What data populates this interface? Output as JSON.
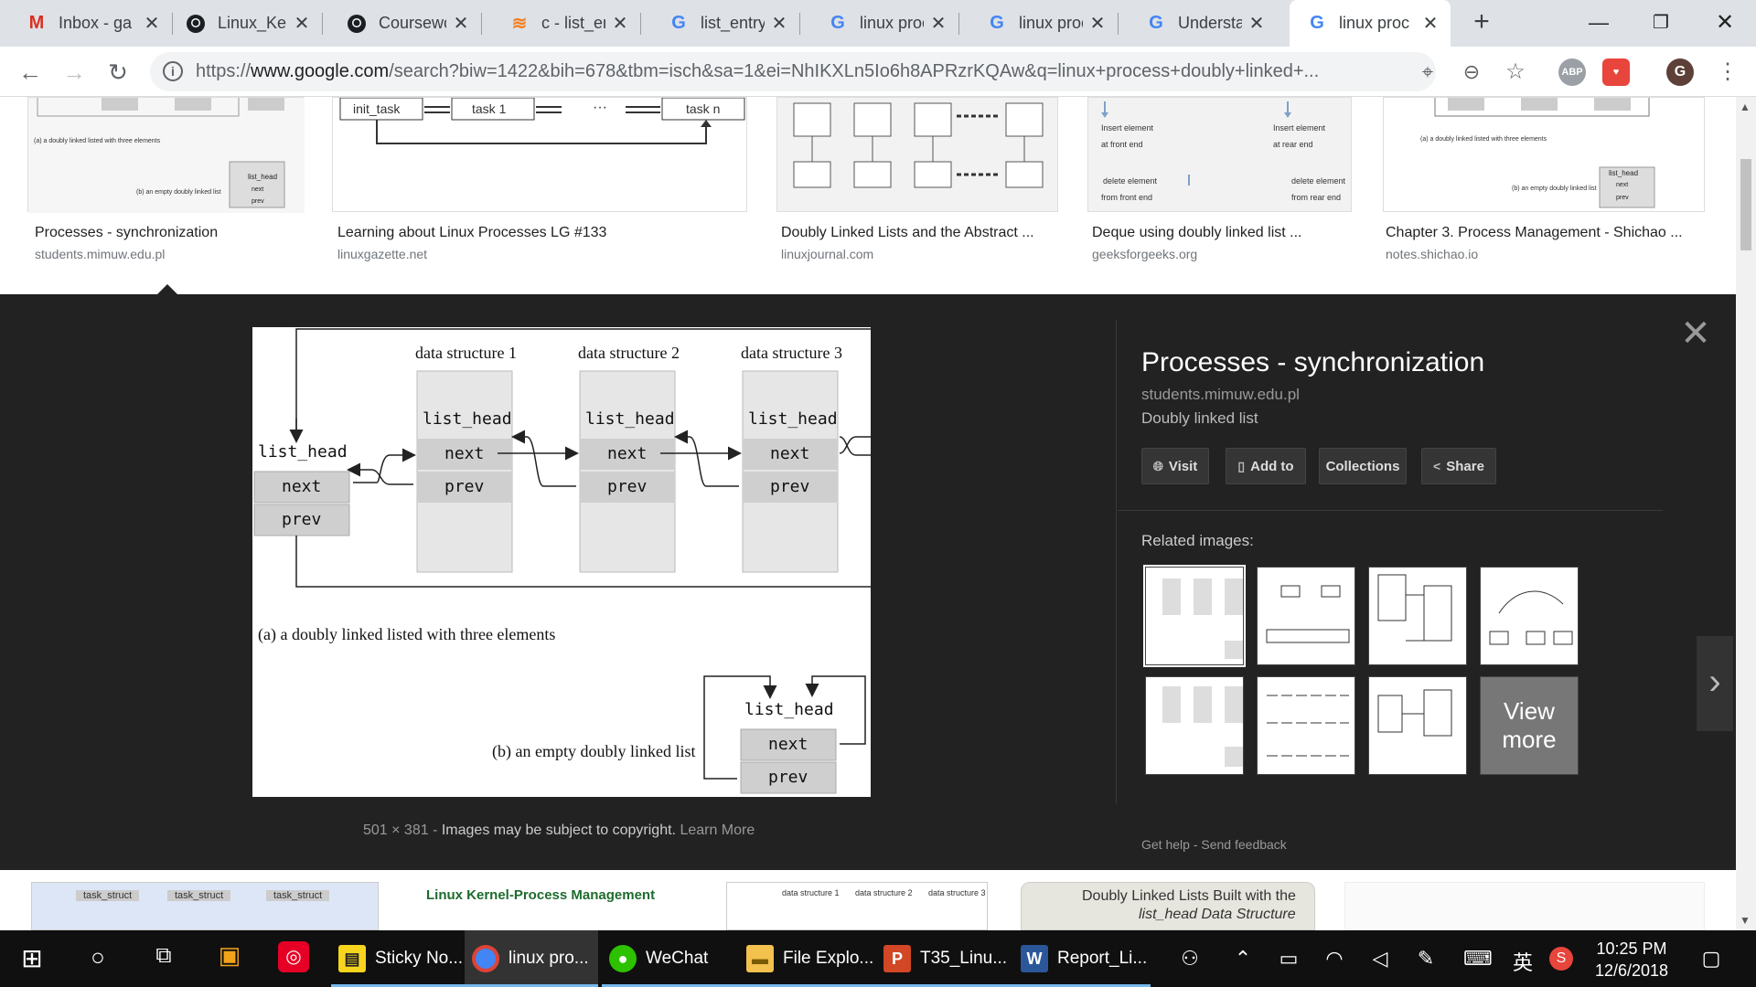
{
  "tabs": [
    {
      "title": "Inbox - ga",
      "icon": "gmail-icon"
    },
    {
      "title": "Linux_Ker",
      "icon": "github-icon"
    },
    {
      "title": "Coursewo",
      "icon": "github-icon"
    },
    {
      "title": "c - list_ent",
      "icon": "stackoverflow-icon"
    },
    {
      "title": "list_entry",
      "icon": "google-icon"
    },
    {
      "title": "linux proc",
      "icon": "google-icon"
    },
    {
      "title": "linux proc",
      "icon": "google-icon"
    },
    {
      "title": "Understar",
      "icon": "google-icon"
    },
    {
      "title": "linux proc",
      "icon": "google-icon"
    }
  ],
  "address_bar": {
    "scheme": "https://",
    "host": "www.google.com",
    "path": "/search?biw=1422&bih=678&tbm=isch&sa=1&ei=NhIKXLn5Io6h8APRzrKQAw&q=linux+process+doubly+linked+..."
  },
  "extensions": {
    "abp": "ABP",
    "profile": "G"
  },
  "top_results": [
    {
      "title": "Processes - synchronization",
      "site": "students.mimuw.edu.pl"
    },
    {
      "title": "Learning about Linux Processes LG #133",
      "site": "linuxgazette.net"
    },
    {
      "title": "Doubly Linked Lists and the Abstract ...",
      "site": "linuxjournal.com"
    },
    {
      "title": "Deque using doubly linked list ...",
      "site": "geeksforgeeks.org"
    },
    {
      "title": "Chapter 3. Process Management - Shichao ...",
      "site": "notes.shichao.io"
    }
  ],
  "thumb_text": {
    "r0_a": "(a) a doubly linked listed with three elements",
    "r0_b": "(b) an empty doubly linked list",
    "list_head": "list_head",
    "next": "next",
    "prev": "prev",
    "init_task": "init_task",
    "task1": "task 1",
    "taskn": "task n",
    "dots": "···",
    "insert_front": "Insert element",
    "at_front_end": "at front end",
    "insert_rear": "Insert element",
    "at_rear_end": "at rear end",
    "delete_front": "delete element",
    "from_front_end": "from front end",
    "delete_rear": "delete element",
    "from_rear_end": "from rear end"
  },
  "viewer": {
    "title": "Processes - synchronization",
    "site": "students.mimuw.edu.pl",
    "description": "Doubly linked list",
    "buttons": {
      "visit": "Visit",
      "add_to": "Add to",
      "collections": "Collections",
      "share": "Share"
    },
    "related_label": "Related images:",
    "view_more": "View more",
    "footer_help": "Get help",
    "footer_sep": "-",
    "footer_feedback": "Send feedback",
    "dimensions": "501 × 381",
    "meta_sep": "-",
    "copyright": "Images may be subject to copyright.",
    "learn_more": "Learn More"
  },
  "diagram": {
    "ds1": "data structure 1",
    "ds2": "data structure 2",
    "ds3": "data structure 3",
    "list_head": "list_head",
    "next": "next",
    "prev": "prev",
    "caption_a": "(a)  a doubly linked listed with three elements",
    "caption_b": "(b)  an empty doubly linked list"
  },
  "bottom_results": {
    "b0_col1": "task_struct",
    "b0_col2": "task_struct",
    "b0_col3": "task_struct",
    "b1_title": "Linux Kernel-Process Management",
    "b2_col1": "data structure 1",
    "b2_col2": "data structure 2",
    "b2_col3": "data structure 3",
    "b3_line1": "Doubly Linked Lists Built with the",
    "b3_line2": "list_head Data Structure"
  },
  "taskbar": {
    "apps": [
      {
        "label": "Sticky No...",
        "icon": "sticky-notes-icon",
        "color": "#f7d51d"
      },
      {
        "label": "linux pro...",
        "icon": "chrome-icon",
        "color": "#4285f4"
      },
      {
        "label": "WeChat",
        "icon": "wechat-icon",
        "color": "#2dc100"
      },
      {
        "label": "File Explo...",
        "icon": "folder-icon",
        "color": "#f2c14e"
      },
      {
        "label": "T35_Linu...",
        "icon": "powerpoint-icon",
        "color": "#d24726"
      },
      {
        "label": "Report_Li...",
        "icon": "word-icon",
        "color": "#2b579a"
      }
    ],
    "ime": "英",
    "time": "10:25 PM",
    "date": "12/6/2018"
  }
}
